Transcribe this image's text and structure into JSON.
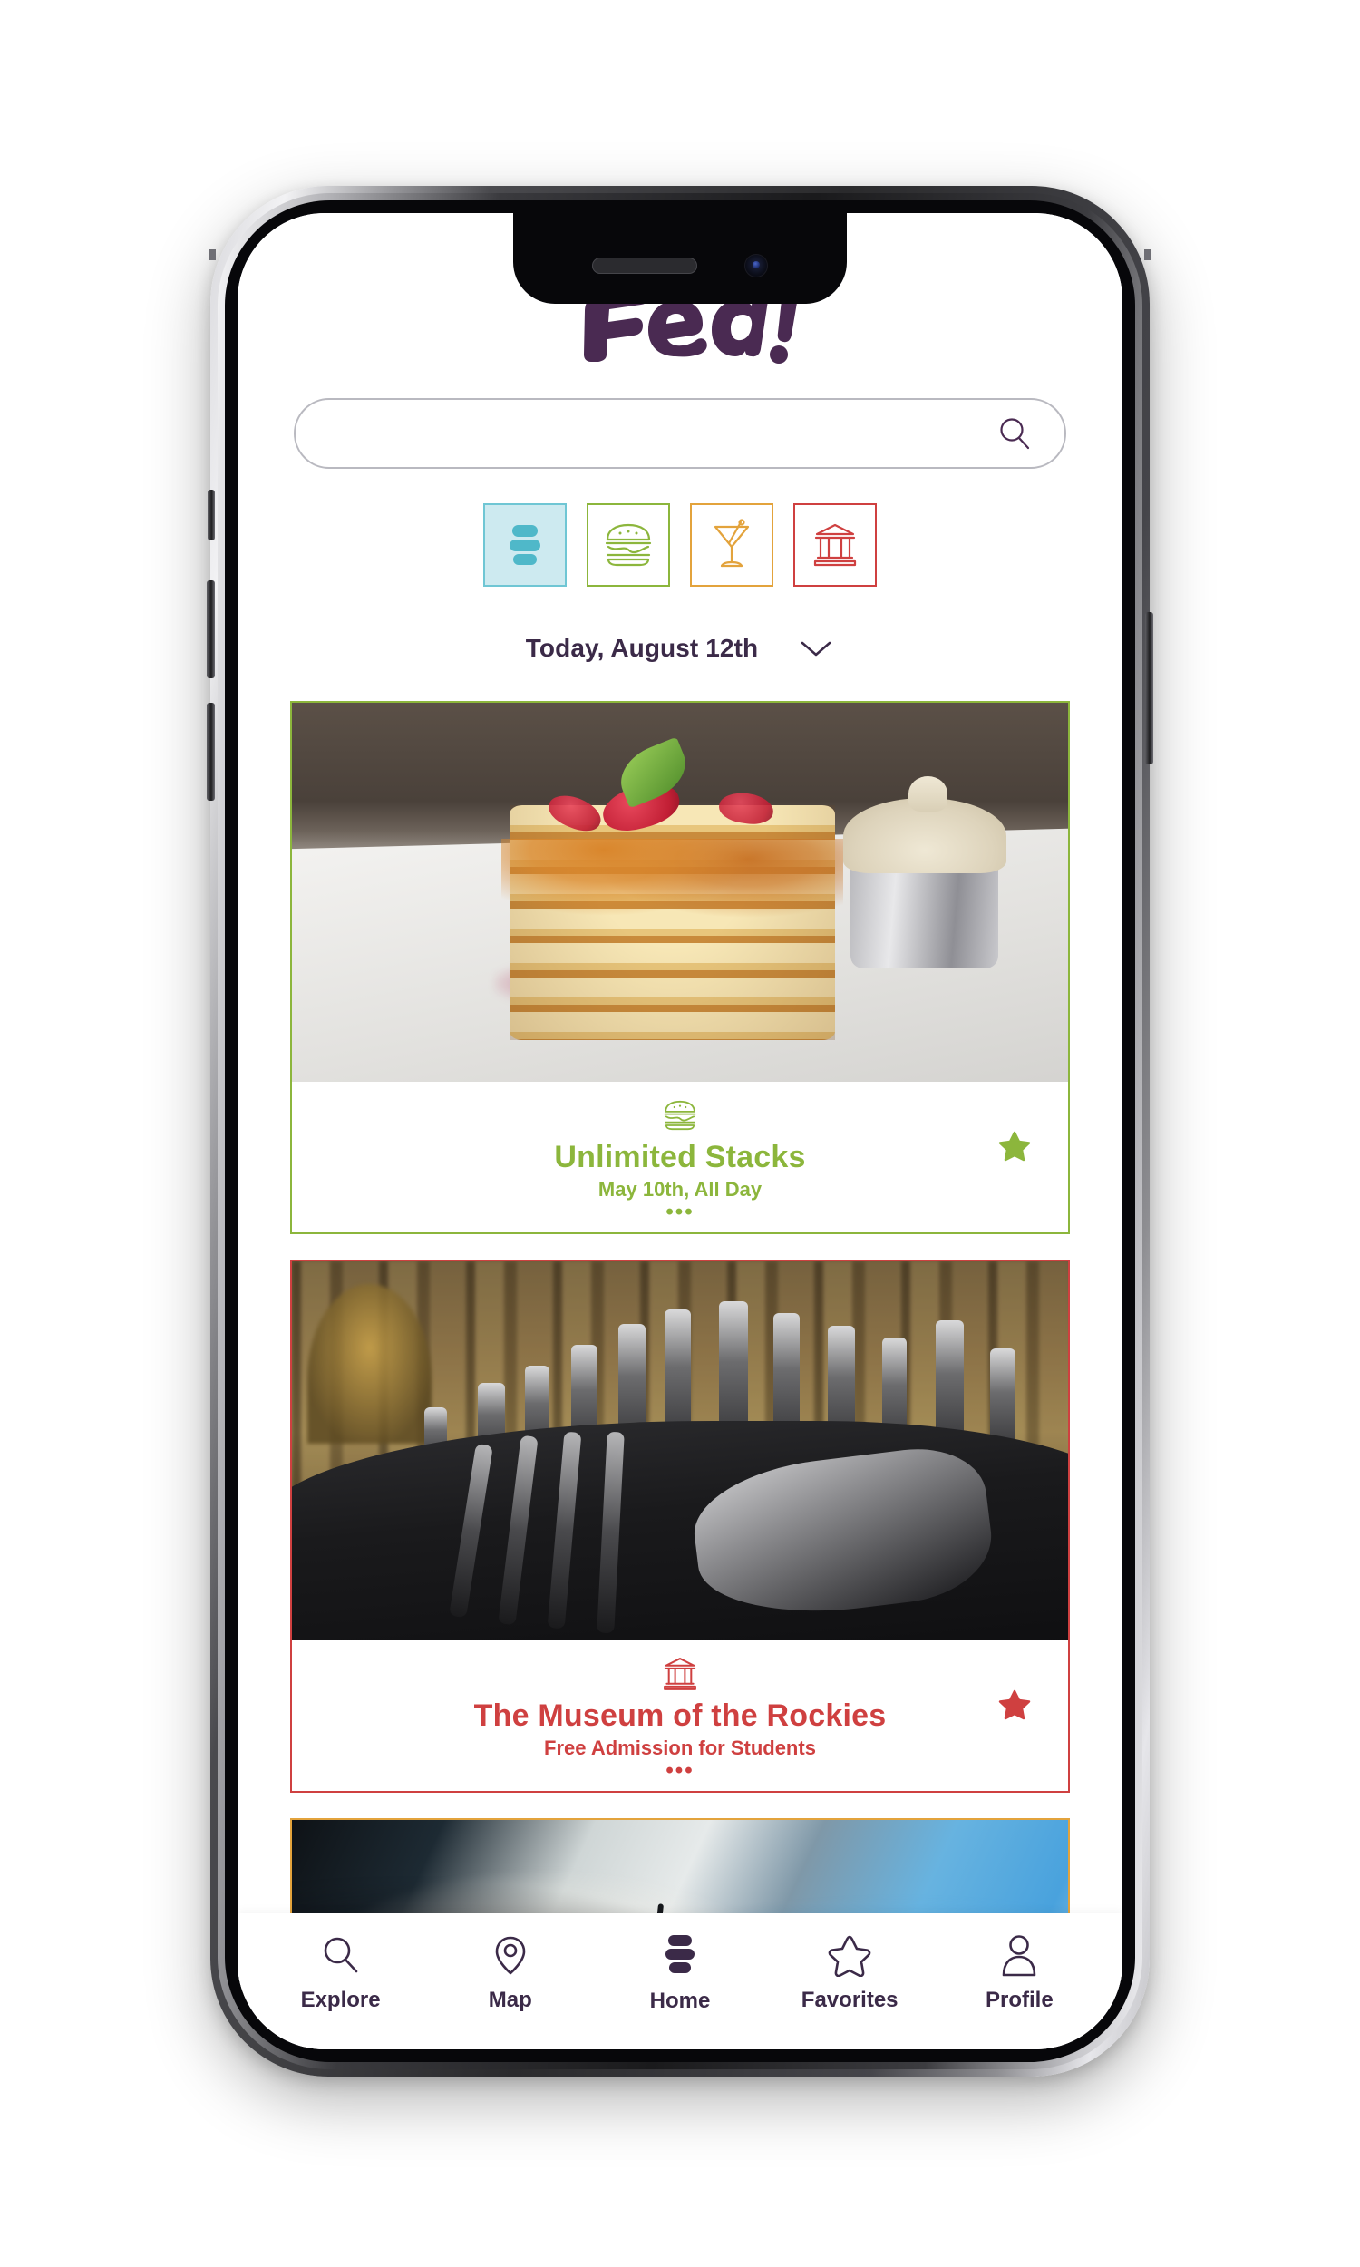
{
  "app": {
    "logo_text": "Fed!",
    "brand_color": "#4a2a52"
  },
  "search": {
    "value": "",
    "placeholder": "",
    "icon": "search-icon"
  },
  "categories": [
    {
      "id": "all",
      "icon": "pancake-stack-icon",
      "color": "#4fb8c9",
      "bg": "#cdeaf0",
      "border": "#6fc6d4",
      "active": true
    },
    {
      "id": "food",
      "icon": "burger-icon",
      "color": "#8cb63c",
      "bg": "#ffffff",
      "border": "#8cb63c",
      "active": false
    },
    {
      "id": "drinks",
      "icon": "cocktail-icon",
      "color": "#e3a33c",
      "bg": "#ffffff",
      "border": "#e3a33c",
      "active": false
    },
    {
      "id": "culture",
      "icon": "museum-icon",
      "color": "#cf4040",
      "bg": "#ffffff",
      "border": "#cf4040",
      "active": false
    }
  ],
  "date_selector": {
    "label": "Today, August 12th",
    "chevron": "chevron-down-icon"
  },
  "cards": [
    {
      "id": "unlimited-stacks",
      "title": "Unlimited Stacks",
      "subtitle": "May 10th, All Day",
      "dots": "•••",
      "icon": "burger-icon",
      "theme": "green",
      "color": "#8cb63c",
      "starred": true,
      "photo": "pancake-stack-photo"
    },
    {
      "id": "museum-of-the-rockies",
      "title": "The Museum of the Rockies",
      "subtitle": "Free Admission for Students",
      "dots": "•••",
      "icon": "museum-icon",
      "theme": "red",
      "color": "#cf4040",
      "starred": true,
      "photo": "dinosaur-skeleton-photo"
    },
    {
      "id": "cocktails-card",
      "title": "",
      "subtitle": "",
      "dots": "",
      "icon": "cocktail-icon",
      "theme": "orange",
      "color": "#e3a33c",
      "starred": false,
      "photo": "cocktails-photo"
    }
  ],
  "navbar": {
    "items": [
      {
        "id": "explore",
        "label": "Explore",
        "icon": "search-icon",
        "active": false
      },
      {
        "id": "map",
        "label": "Map",
        "icon": "map-pin-icon",
        "active": false
      },
      {
        "id": "home",
        "label": "Home",
        "icon": "pancake-stack-icon",
        "active": true
      },
      {
        "id": "favorites",
        "label": "Favorites",
        "icon": "star-outline-icon",
        "active": false
      },
      {
        "id": "profile",
        "label": "Profile",
        "icon": "person-icon",
        "active": false
      }
    ]
  }
}
